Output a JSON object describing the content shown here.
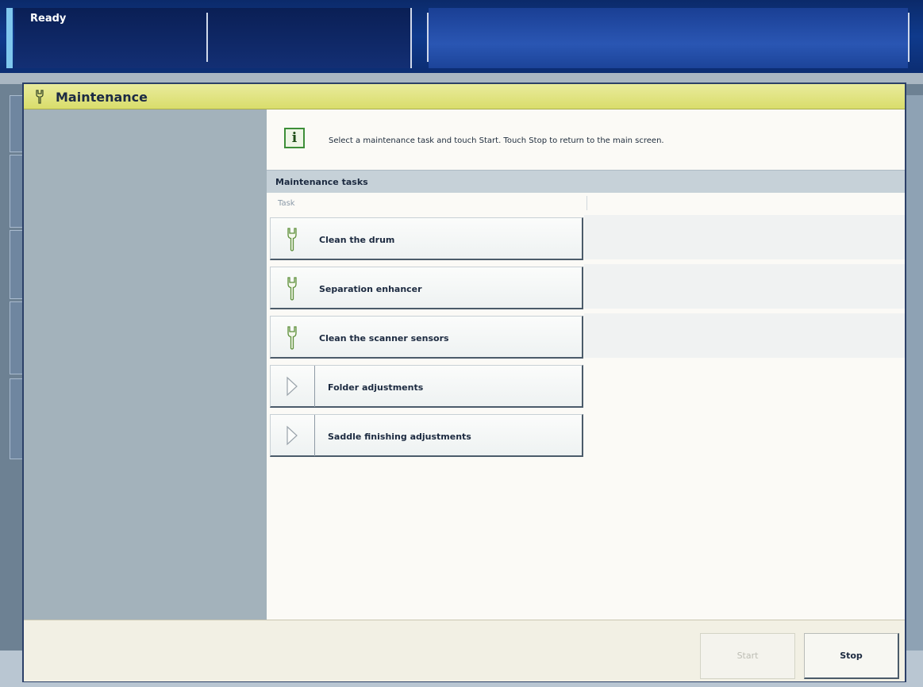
{
  "status_bar": {
    "status": "Ready"
  },
  "dialog": {
    "title": "Maintenance",
    "icon": "wrench-icon",
    "info_icon": "info-icon",
    "info_message": "Select a maintenance task and touch Start. Touch Stop to return to the main screen.",
    "section_title": "Maintenance tasks",
    "column_task": "Task",
    "tasks": [
      {
        "label": "Clean the drum",
        "icon": "wrench-icon"
      },
      {
        "label": "Separation enhancer",
        "icon": "wrench-icon"
      },
      {
        "label": "Clean the scanner sensors",
        "icon": "wrench-icon"
      },
      {
        "label": "Folder adjustments",
        "icon": "play-arrow-icon"
      },
      {
        "label": "Saddle finishing adjustments",
        "icon": "play-arrow-icon"
      }
    ],
    "buttons": {
      "start": "Start",
      "stop": "Stop"
    }
  },
  "colors": {
    "header": "#dfe27a",
    "sidebar": "#a3b2bb",
    "section_header": "#c6d1d8",
    "status_bar": "#0f3a8c"
  }
}
